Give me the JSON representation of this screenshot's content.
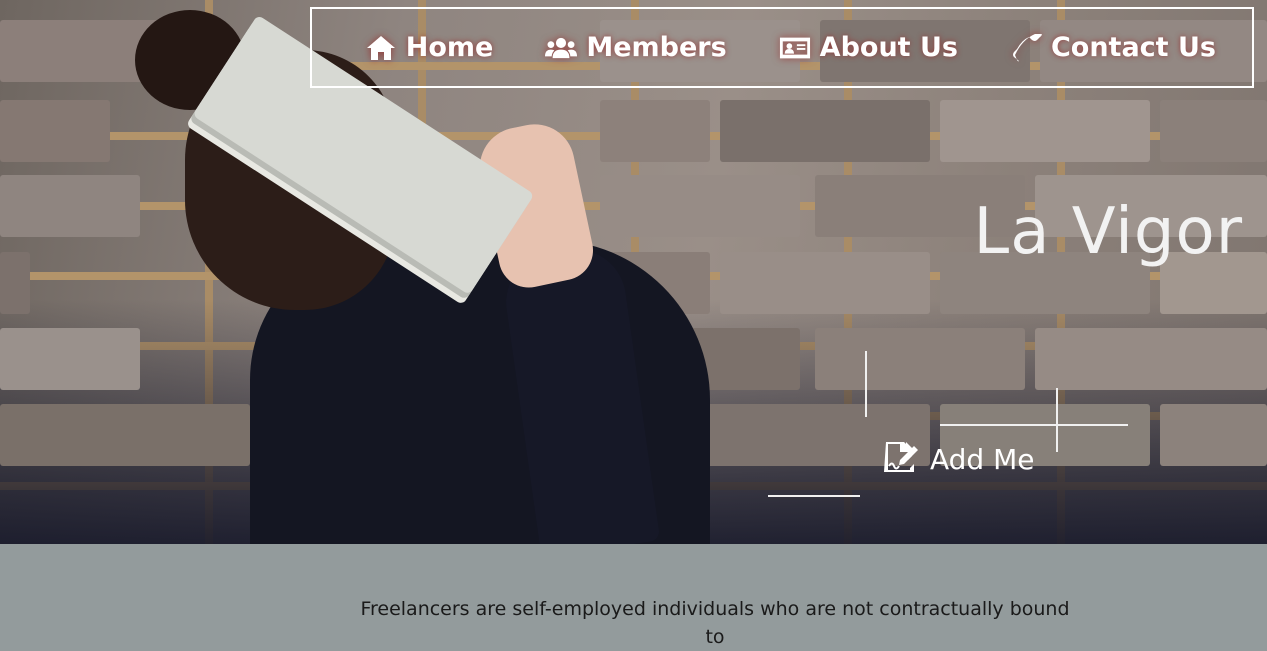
{
  "nav": {
    "items": [
      {
        "label": "Home",
        "icon": "home-icon"
      },
      {
        "label": "Members",
        "icon": "users-icon"
      },
      {
        "label": "About Us",
        "icon": "id-card-icon"
      },
      {
        "label": "Contact Us",
        "icon": "phone-icon"
      }
    ]
  },
  "hero": {
    "title": "La Vigor",
    "add_button": {
      "label": "Add Me",
      "icon": "file-signature-icon"
    }
  },
  "intro": {
    "text": "Freelancers are self-employed individuals who are not contractually bound to"
  },
  "colors": {
    "intro_background": "#939b9c",
    "text_light": "#ffffff",
    "text_dark": "#1a1a1a"
  }
}
